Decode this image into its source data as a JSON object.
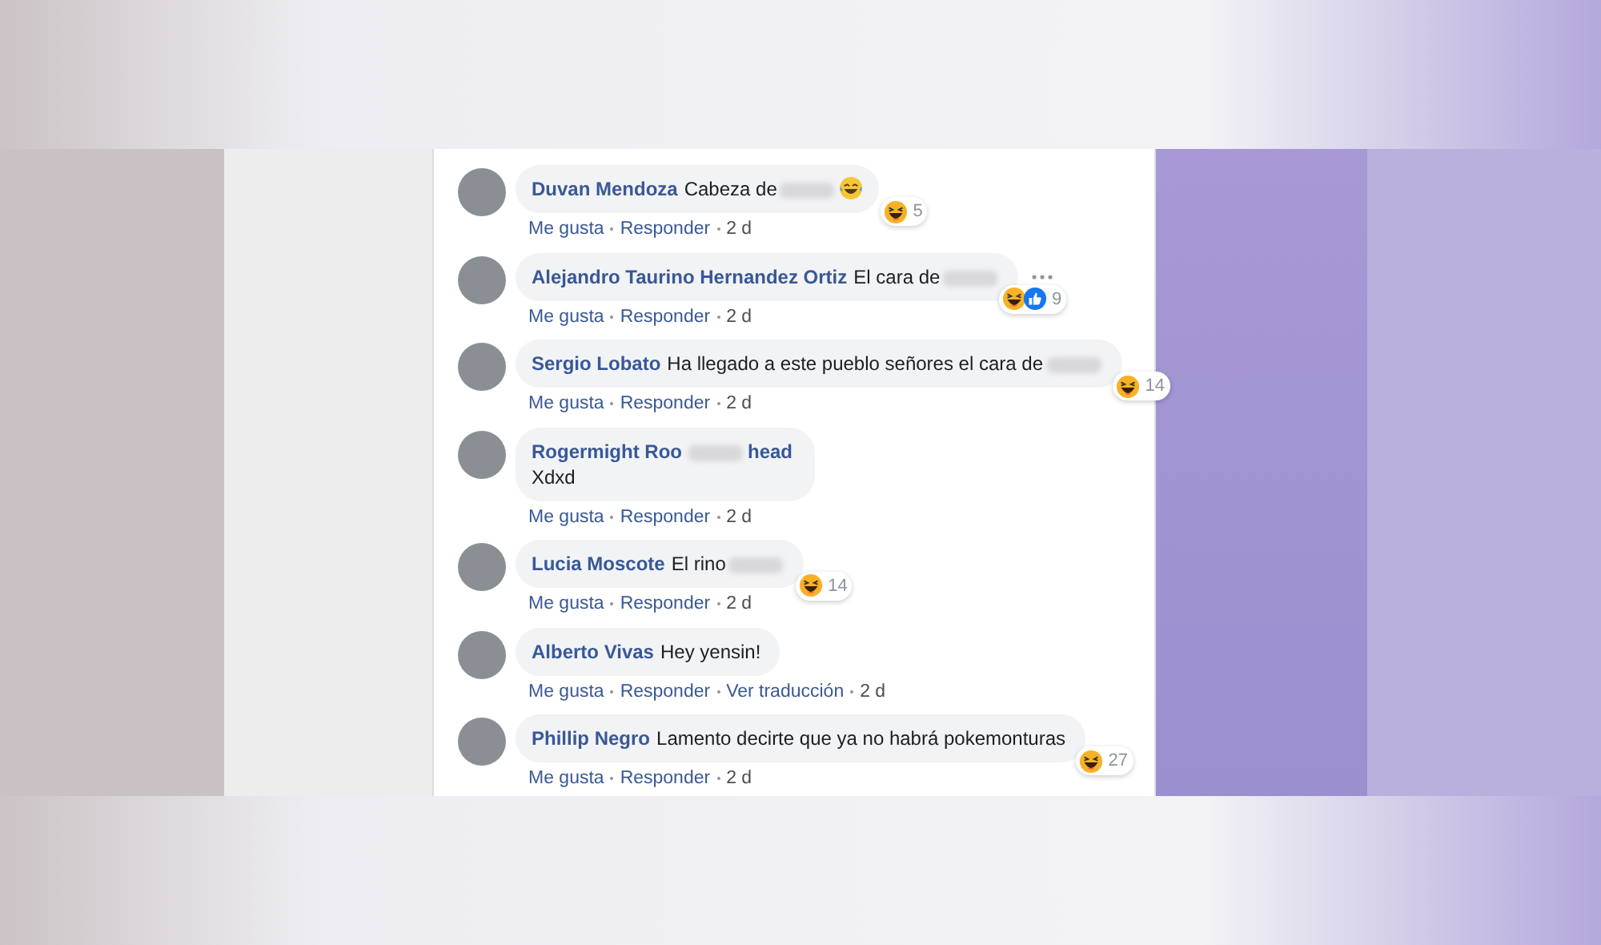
{
  "comments": [
    {
      "name": [
        {
          "kind": "text",
          "text": "Duvan Mendoza"
        }
      ],
      "body": [
        {
          "kind": "text",
          "text": "Cabeza de"
        },
        {
          "kind": "redacted"
        },
        {
          "kind": "emoji"
        }
      ],
      "reactions": {
        "icons": [
          {
            "kind": "haha"
          }
        ],
        "count": "5"
      },
      "more": false,
      "actions": [
        {
          "label": "Me gusta"
        },
        {
          "label": "Responder"
        }
      ],
      "time": "2 d"
    },
    {
      "name": [
        {
          "kind": "text",
          "text": "Alejandro Taurino Hernandez Ortiz"
        }
      ],
      "body": [
        {
          "kind": "text",
          "text": "El cara de"
        },
        {
          "kind": "redacted"
        }
      ],
      "reactions": {
        "icons": [
          {
            "kind": "haha"
          },
          {
            "kind": "like"
          }
        ],
        "count": "9"
      },
      "more": true,
      "actions": [
        {
          "label": "Me gusta"
        },
        {
          "label": "Responder"
        }
      ],
      "time": "2 d"
    },
    {
      "name": [
        {
          "kind": "text",
          "text": "Sergio Lobato"
        }
      ],
      "body": [
        {
          "kind": "text",
          "text": "Ha llegado a este pueblo señores el cara de"
        },
        {
          "kind": "redacted"
        }
      ],
      "reactions": {
        "icons": [
          {
            "kind": "haha"
          }
        ],
        "count": "14"
      },
      "more": false,
      "actions": [
        {
          "label": "Me gusta"
        },
        {
          "label": "Responder"
        }
      ],
      "time": "2 d"
    },
    {
      "name": [
        {
          "kind": "text",
          "text": "Rogermight Roo"
        },
        {
          "kind": "redacted"
        },
        {
          "kind": "text",
          "text": "head"
        }
      ],
      "body": [
        {
          "kind": "break"
        },
        {
          "kind": "text",
          "text": "Xdxd"
        }
      ],
      "more": false,
      "actions": [
        {
          "label": "Me gusta"
        },
        {
          "label": "Responder"
        }
      ],
      "time": "2 d"
    },
    {
      "name": [
        {
          "kind": "text",
          "text": "Lucia Moscote"
        }
      ],
      "body": [
        {
          "kind": "text",
          "text": "El rino"
        },
        {
          "kind": "redacted"
        }
      ],
      "reactions": {
        "icons": [
          {
            "kind": "haha"
          }
        ],
        "count": "14"
      },
      "more": false,
      "actions": [
        {
          "label": "Me gusta"
        },
        {
          "label": "Responder"
        }
      ],
      "time": "2 d"
    },
    {
      "name": [
        {
          "kind": "text",
          "text": "Alberto Vivas"
        }
      ],
      "body": [
        {
          "kind": "text",
          "text": "Hey yensin!"
        }
      ],
      "more": false,
      "actions": [
        {
          "label": "Me gusta"
        },
        {
          "label": "Responder"
        },
        {
          "label": "Ver traducción"
        }
      ],
      "time": "2 d"
    },
    {
      "name": [
        {
          "kind": "text",
          "text": "Phillip Negro"
        }
      ],
      "body": [
        {
          "kind": "text",
          "text": "Lamento decirte que ya no habrá pokemonturas"
        }
      ],
      "reactions": {
        "icons": [
          {
            "kind": "haha"
          }
        ],
        "count": "27"
      },
      "more": false,
      "actions": [
        {
          "label": "Me gusta"
        },
        {
          "label": "Responder"
        }
      ],
      "time": "2 d"
    }
  ]
}
